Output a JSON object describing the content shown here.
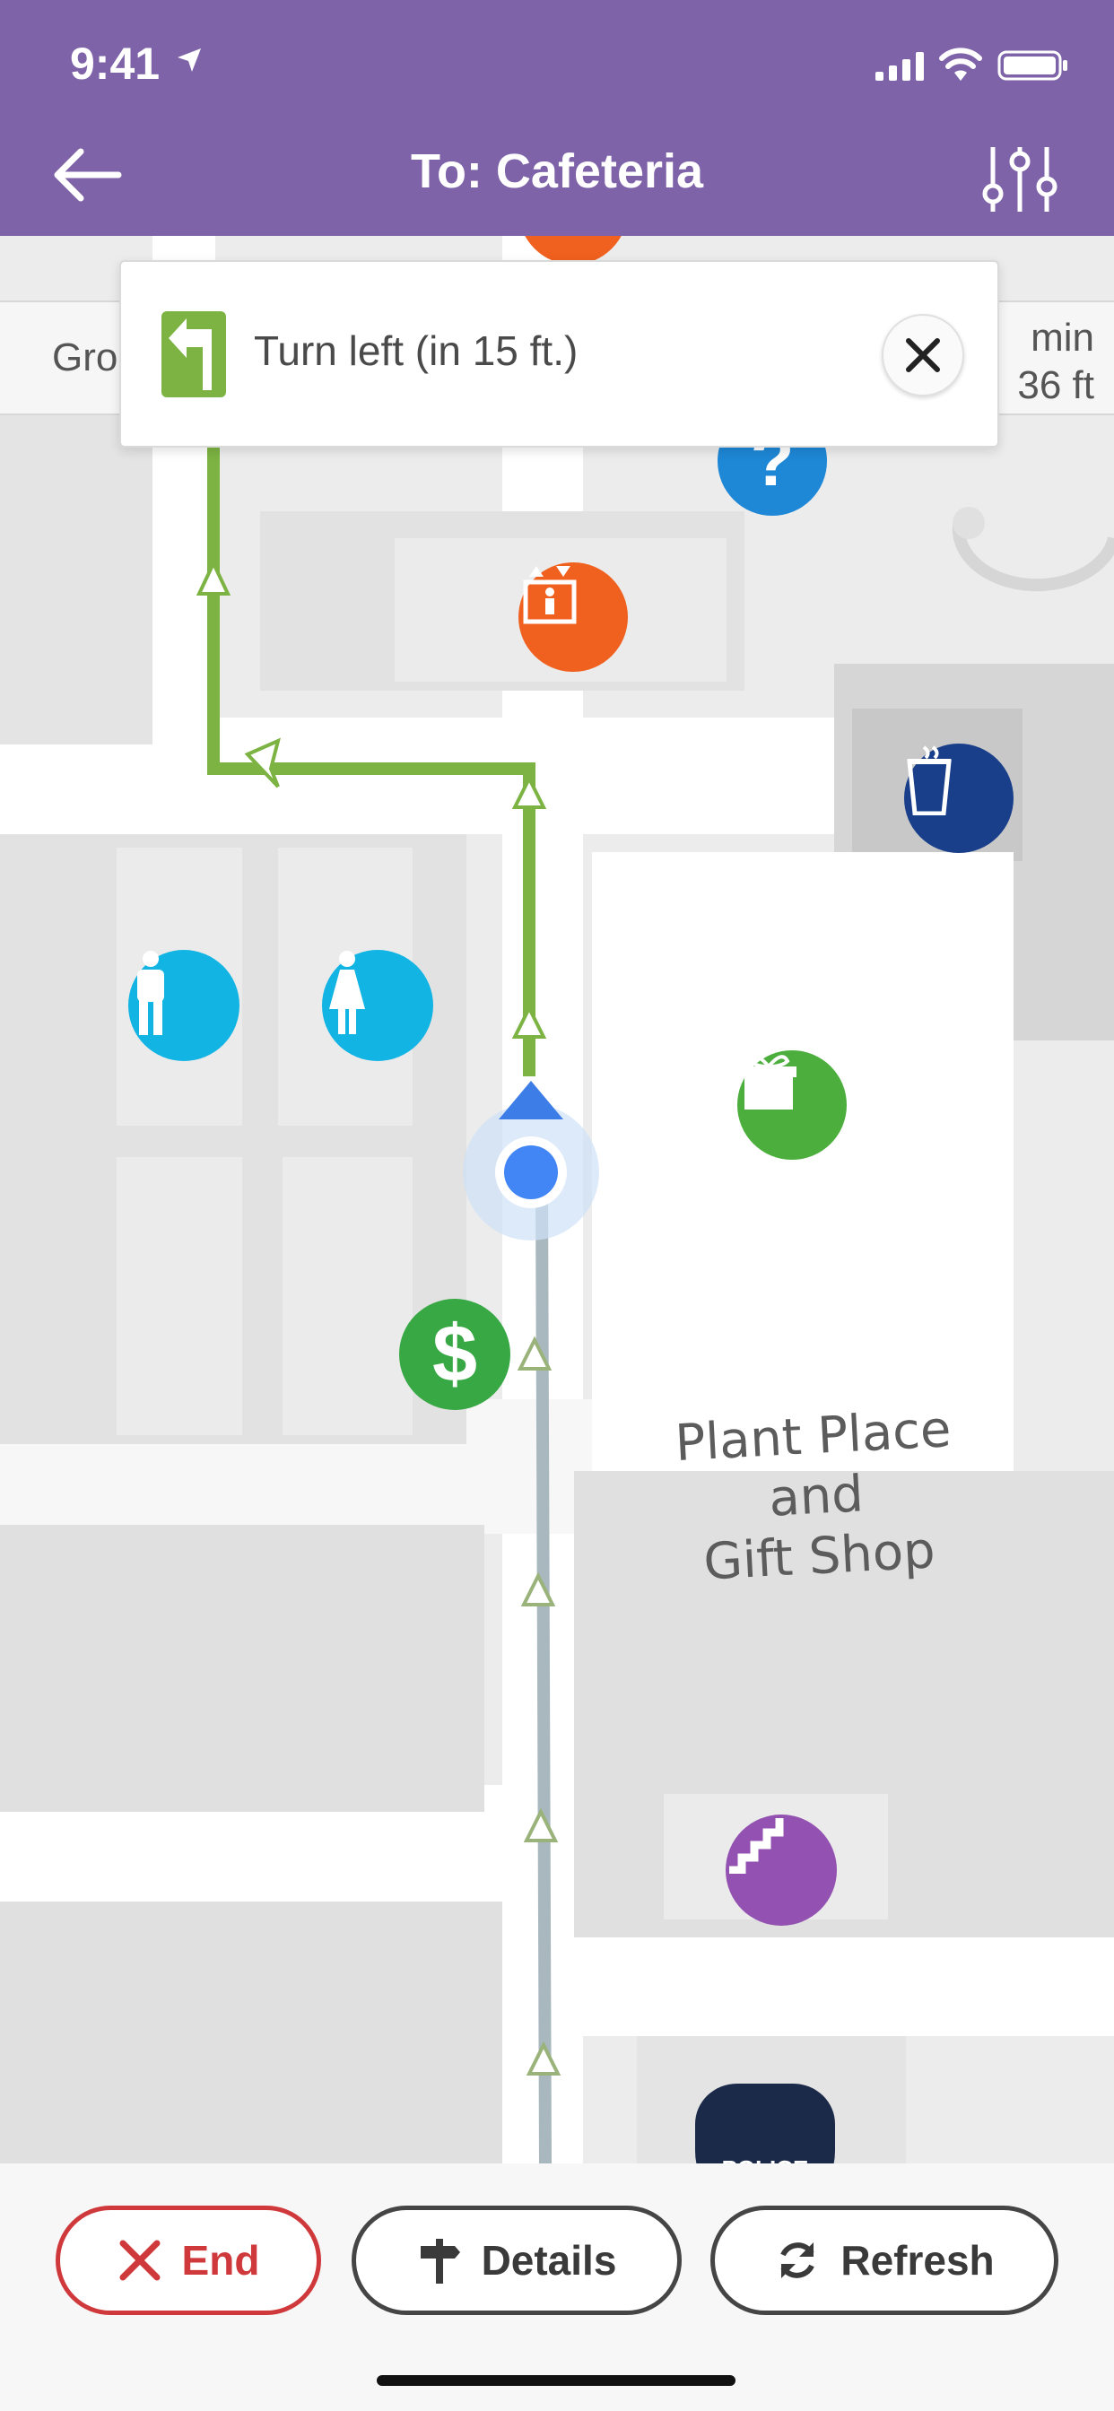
{
  "status_bar": {
    "time": "9:41"
  },
  "nav": {
    "title": "To: Cafeteria"
  },
  "info_strip": {
    "left_text": "Gro",
    "time_text": "min",
    "distance_text": "36 ft"
  },
  "instruction": {
    "text": "Turn left (in 15 ft.)"
  },
  "map": {
    "store_label": [
      "Plant Place",
      "and",
      "Gift Shop"
    ],
    "police_label": "POLICE"
  },
  "actions": {
    "end": "End",
    "details": "Details",
    "refresh": "Refresh"
  },
  "colors": {
    "header": "#7e63a9",
    "route_active": "#7cb342",
    "route_upcoming": "#a9b8bf",
    "end": "#d0393b"
  }
}
